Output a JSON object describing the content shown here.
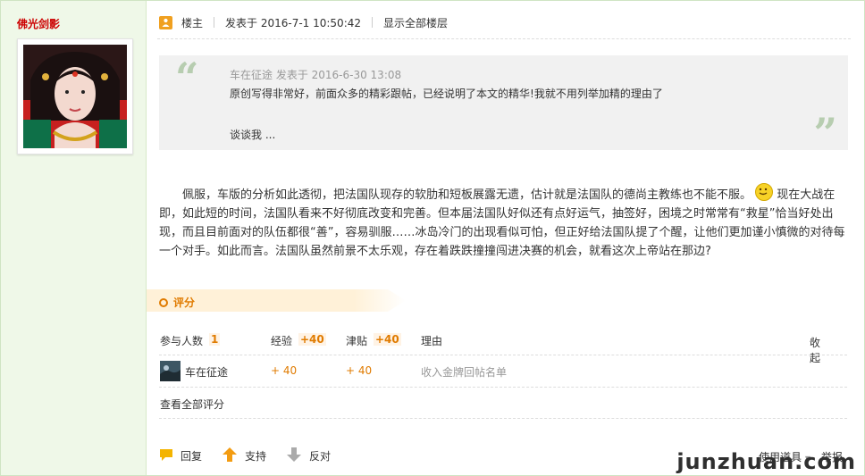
{
  "sidebar": {
    "author": "佛光剑影"
  },
  "post_header": {
    "badge": "楼主",
    "posted": "发表于 2016-7-1 10:50:42",
    "show_all": "显示全部楼层"
  },
  "quote": {
    "author_line": "车在征途 发表于 2016-6-30 13:08",
    "text": "原创写得非常好，前面众多的精彩跟帖，已经说明了本文的精华!我就不用列举加精的理由了",
    "more": "谈谈我 ..."
  },
  "body": {
    "before_emoji": "佩服，车版的分析如此透彻，把法国队现存的软肋和短板展露无遗，估计就是法国队的德尚主教练也不能不服。",
    "after_emoji": "现在大战在即，如此短的时间，法国队看来不好彻底改变和完善。但本届法国队好似还有点好运气，抽签好，困境之时常常有“救星”恰当好处出现，而且目前面对的队伍都很“善”，容易驯服……冰岛冷门的出现看似可怕，但正好给法国队提了个醒，让他们更加谨小慎微的对待每一个对手。如此而言。法国队虽然前景不太乐观，存在着跌跌撞撞闯进决赛的机会，就看这次上帝站在那边?"
  },
  "rating": {
    "tab": "评分",
    "participants_label": "参与人数",
    "participants_count": "1",
    "exp_label": "经验",
    "exp_total": "+40",
    "gold_label": "津贴",
    "gold_total": "+40",
    "reason_label": "理由",
    "collapse": "收起",
    "row": {
      "user": "车在征途",
      "exp": "+ 40",
      "gold": "+ 40",
      "reason": "收入金牌回帖名单"
    },
    "view_all": "查看全部评分"
  },
  "actions": {
    "reply": "回复",
    "support": "支持",
    "oppose": "反对",
    "tools": "使用道具",
    "report": "举报"
  },
  "watermark": "junzhuan.com",
  "colors": {
    "sidebar_bg": "#eff8e8",
    "accent_orange": "#e07b00",
    "quote_bg": "#f1f1f1",
    "author_red": "#cc0000"
  }
}
